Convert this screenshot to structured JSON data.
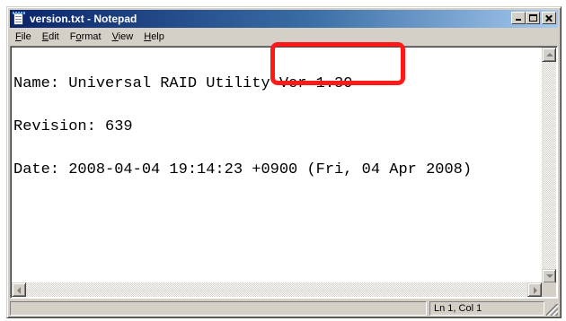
{
  "window": {
    "title": "version.txt - Notepad"
  },
  "menu": {
    "items": [
      {
        "label_acc": "F",
        "label_rest": "ile"
      },
      {
        "label_acc": "E",
        "label_rest": "dit"
      },
      {
        "label_pre": "F",
        "label_acc": "o",
        "label_rest": "rmat"
      },
      {
        "label_acc": "V",
        "label_rest": "iew"
      },
      {
        "label_acc": "H",
        "label_rest": "elp"
      }
    ]
  },
  "document": {
    "lines": [
      "Name: Universal RAID Utility Ver 1.30",
      "Revision: 639",
      "Date: 2008-04-04 19:14:23 +0900 (Fri, 04 Apr 2008)"
    ]
  },
  "status": {
    "main": "",
    "position": "Ln 1, Col 1"
  },
  "annotation": {
    "highlight_color": "#ff1a1a"
  },
  "theme": {
    "titlebar_start": "#0a246a",
    "titlebar_end": "#a6caf0",
    "face": "#d4d0c8"
  }
}
